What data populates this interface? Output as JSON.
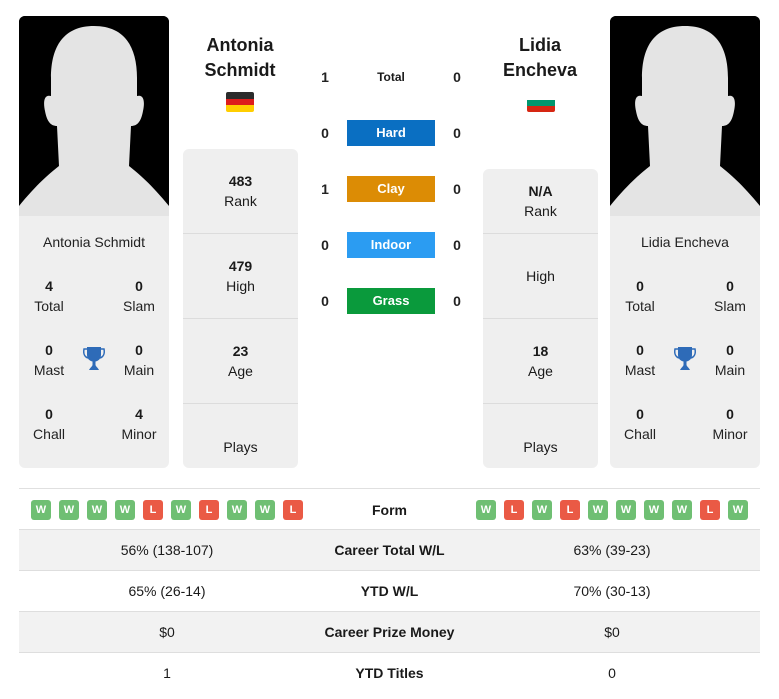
{
  "player1": {
    "name": "Antonia Schmidt",
    "name_line1": "Antonia",
    "name_line2": "Schmidt",
    "flag": "germany-flag",
    "flag_colors": [
      "#2b2b2b",
      "#dd1c1c",
      "#ffce00"
    ],
    "titles": {
      "total": {
        "value": "4",
        "label": "Total"
      },
      "slam": {
        "value": "0",
        "label": "Slam"
      },
      "mast": {
        "value": "0",
        "label": "Mast"
      },
      "main": {
        "value": "0",
        "label": "Main"
      },
      "chall": {
        "value": "0",
        "label": "Chall"
      },
      "minor": {
        "value": "4",
        "label": "Minor"
      }
    },
    "stats": {
      "rank": {
        "value": "483",
        "label": "Rank"
      },
      "high": {
        "value": "479",
        "label": "High"
      },
      "age": {
        "value": "23",
        "label": "Age"
      },
      "plays": {
        "value": "",
        "label": "Plays"
      }
    },
    "form": [
      "W",
      "W",
      "W",
      "W",
      "L",
      "W",
      "L",
      "W",
      "W",
      "L"
    ]
  },
  "player2": {
    "name": "Lidia Encheva",
    "name_line1": "Lidia",
    "name_line2": "Encheva",
    "flag": "bulgaria-flag",
    "flag_colors": [
      "#ffffff",
      "#00966e",
      "#d62612"
    ],
    "titles": {
      "total": {
        "value": "0",
        "label": "Total"
      },
      "slam": {
        "value": "0",
        "label": "Slam"
      },
      "mast": {
        "value": "0",
        "label": "Mast"
      },
      "main": {
        "value": "0",
        "label": "Main"
      },
      "chall": {
        "value": "0",
        "label": "Chall"
      },
      "minor": {
        "value": "0",
        "label": "Minor"
      }
    },
    "stats": {
      "rank": {
        "value": "N/A",
        "label": "Rank"
      },
      "high": {
        "value": "",
        "label": "High"
      },
      "age": {
        "value": "18",
        "label": "Age"
      },
      "plays": {
        "value": "",
        "label": "Plays"
      }
    },
    "form": [
      "W",
      "L",
      "W",
      "L",
      "W",
      "W",
      "W",
      "W",
      "L",
      "W"
    ]
  },
  "h2h": [
    {
      "surface": "Total",
      "p1": "1",
      "p2": "0",
      "color": ""
    },
    {
      "surface": "Hard",
      "p1": "0",
      "p2": "0",
      "color": "#0a6fc2"
    },
    {
      "surface": "Clay",
      "p1": "1",
      "p2": "0",
      "color": "#dc8c05"
    },
    {
      "surface": "Indoor",
      "p1": "0",
      "p2": "0",
      "color": "#2b9cf2"
    },
    {
      "surface": "Grass",
      "p1": "0",
      "p2": "0",
      "color": "#0a9a3c"
    }
  ],
  "comparison": {
    "form_label": "Form",
    "rows": [
      {
        "label": "Career Total W/L",
        "p1": "56% (138-107)",
        "p2": "63% (39-23)"
      },
      {
        "label": "YTD W/L",
        "p1": "65% (26-14)",
        "p2": "70% (30-13)"
      },
      {
        "label": "Career Prize Money",
        "p1": "$0",
        "p2": "$0"
      },
      {
        "label": "YTD Titles",
        "p1": "1",
        "p2": "0"
      }
    ]
  },
  "colors": {
    "win": "#6fbf73",
    "loss": "#ea5a45",
    "trophy": "#2e6bb8"
  }
}
